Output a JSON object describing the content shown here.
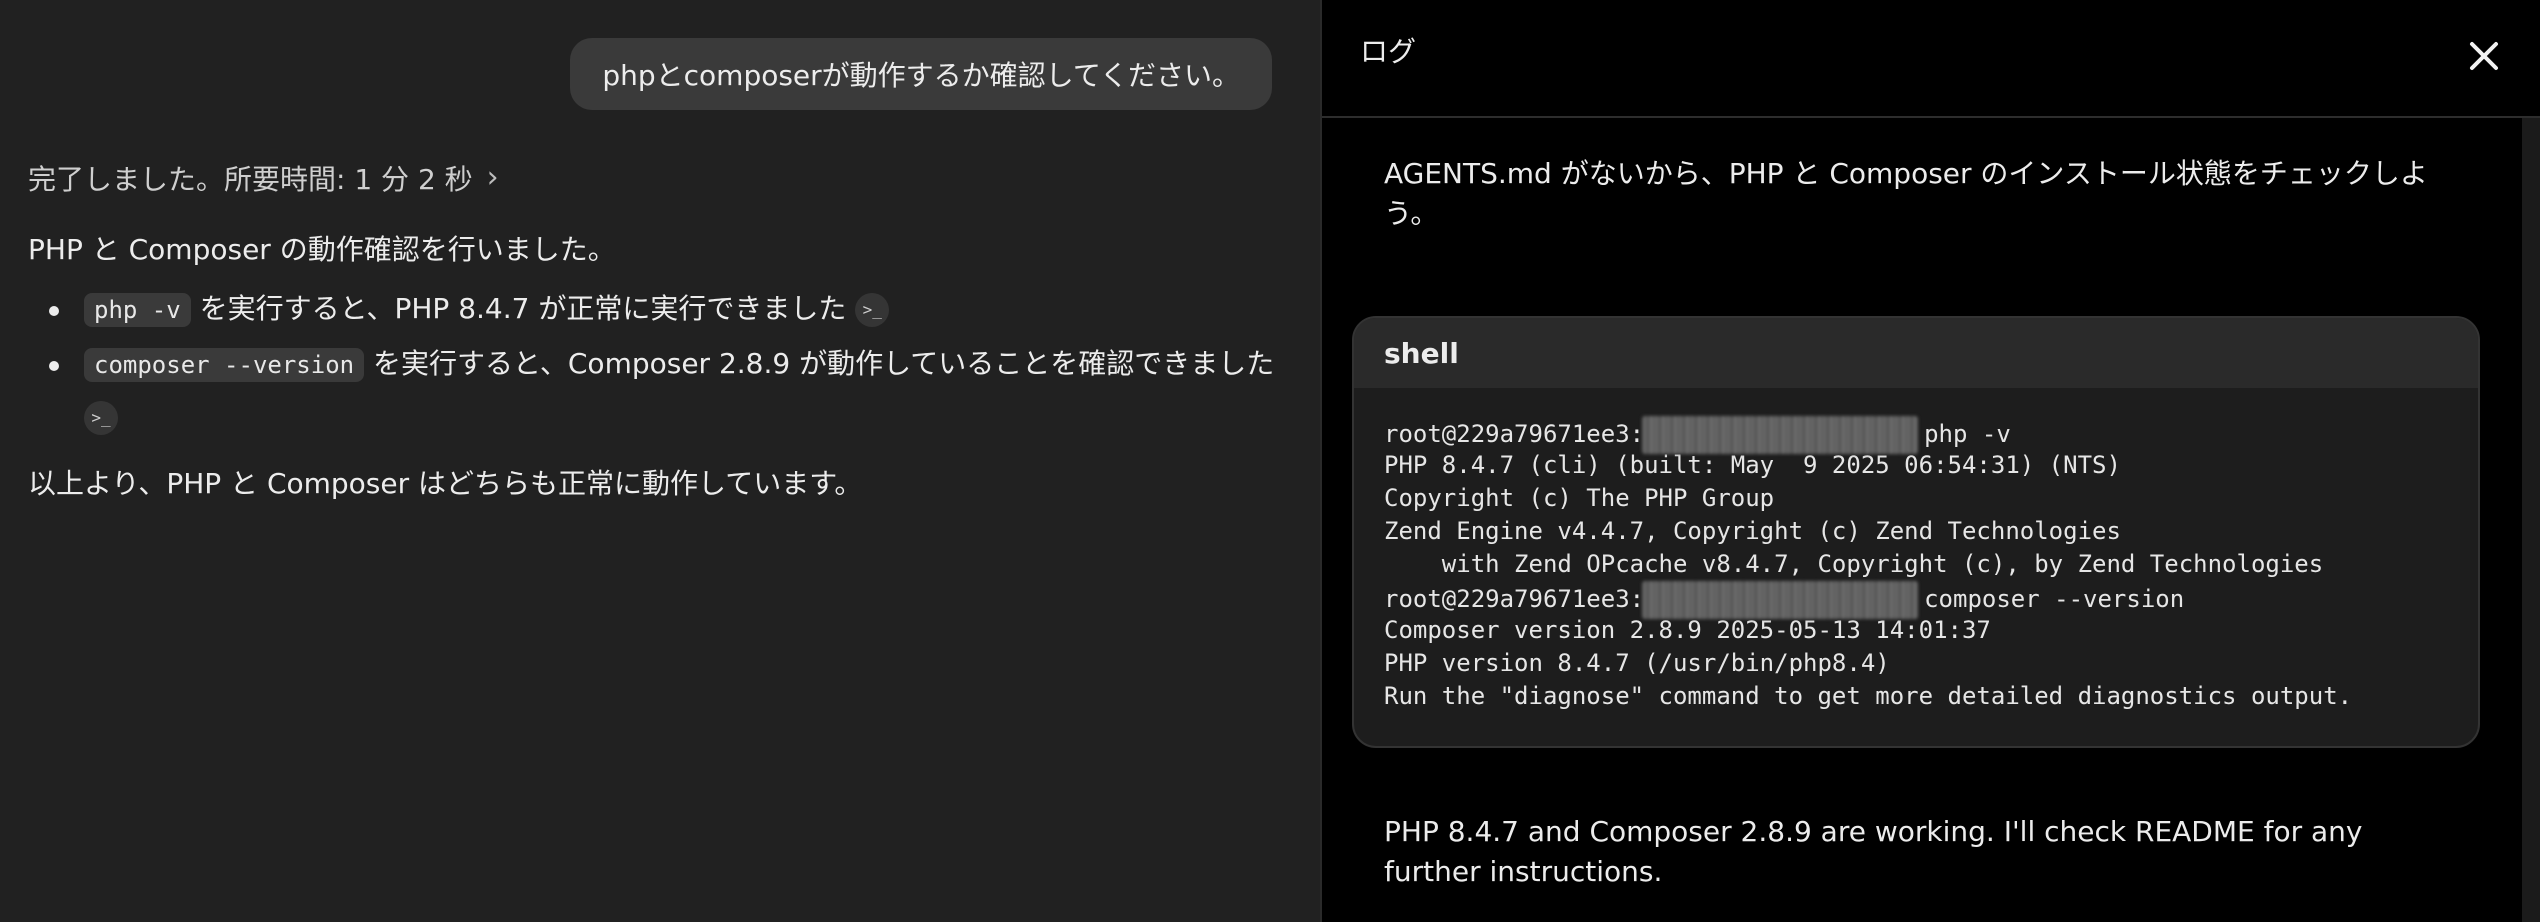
{
  "chat": {
    "user_message": "phpとcomposerが動作するか確認してください。",
    "duration": "完了しました。所要時間: 1 分 2 秒",
    "answer": {
      "intro": "PHP と Composer の動作確認を行いました。",
      "items": [
        {
          "code": "php -v",
          "text": "を実行すると、PHP 8.4.7 が正常に実行できました"
        },
        {
          "code": "composer --version",
          "text": "を実行すると、Composer 2.8.9 が動作していることを確認できました"
        }
      ],
      "conclusion": "以上より、PHP と Composer はどちらも正常に動作しています。"
    }
  },
  "log_panel": {
    "title": "ログ",
    "message1": "AGENTS.md がないから、PHP と Composer のインストール状態をチェックしよう。",
    "shell": {
      "header": "shell",
      "prompt1": "root@229a79671ee3:",
      "cmd1": "php -v",
      "out1": [
        "PHP 8.4.7 (cli) (built: May  9 2025 06:54:31) (NTS)",
        "Copyright (c) The PHP Group",
        "Zend Engine v4.4.7, Copyright (c) Zend Technologies",
        "    with Zend OPcache v8.4.7, Copyright (c), by Zend Technologies"
      ],
      "prompt2": "root@229a79671ee3:",
      "cmd2": "composer --version",
      "out2": [
        "Composer version 2.8.9 2025-05-13 14:01:37",
        "PHP version 8.4.7 (/usr/bin/php8.4)",
        "Run the \"diagnose\" command to get more detailed diagnostics output."
      ]
    },
    "message2": "PHP 8.4.7 and Composer 2.8.9 are working. I'll check README for any further instructions."
  },
  "icons": {
    "close": "close-icon",
    "chevron": "chevron-right-icon",
    "terminal": "terminal-icon"
  }
}
